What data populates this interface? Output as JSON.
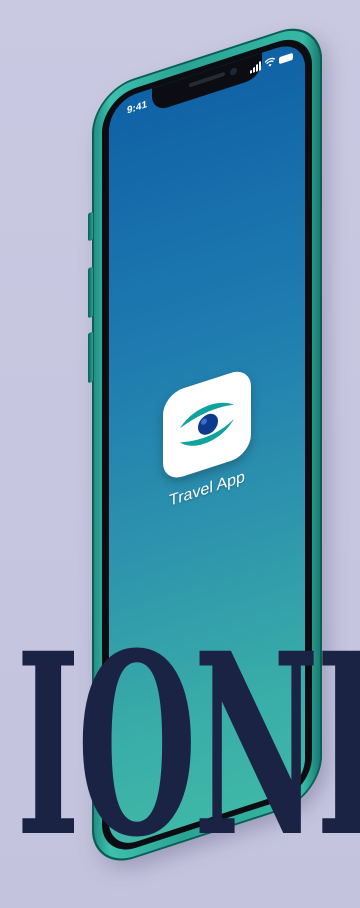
{
  "status_bar": {
    "time": "9:41",
    "icons": [
      "signal-icon",
      "wifi-icon",
      "battery-icon"
    ]
  },
  "home_screen": {
    "app": {
      "label": "Travel App",
      "icon": "eye-swoosh-logo-icon",
      "accent_colors": [
        "#0e9e9a",
        "#0d3a8c"
      ]
    }
  },
  "headline": {
    "text": "IONE."
  },
  "colors": {
    "background": "#c6c6df",
    "device_frame": "#2aa394",
    "screen_top": "#0f62a6",
    "screen_bottom": "#3fb7a7",
    "headline": "#1b2344"
  }
}
